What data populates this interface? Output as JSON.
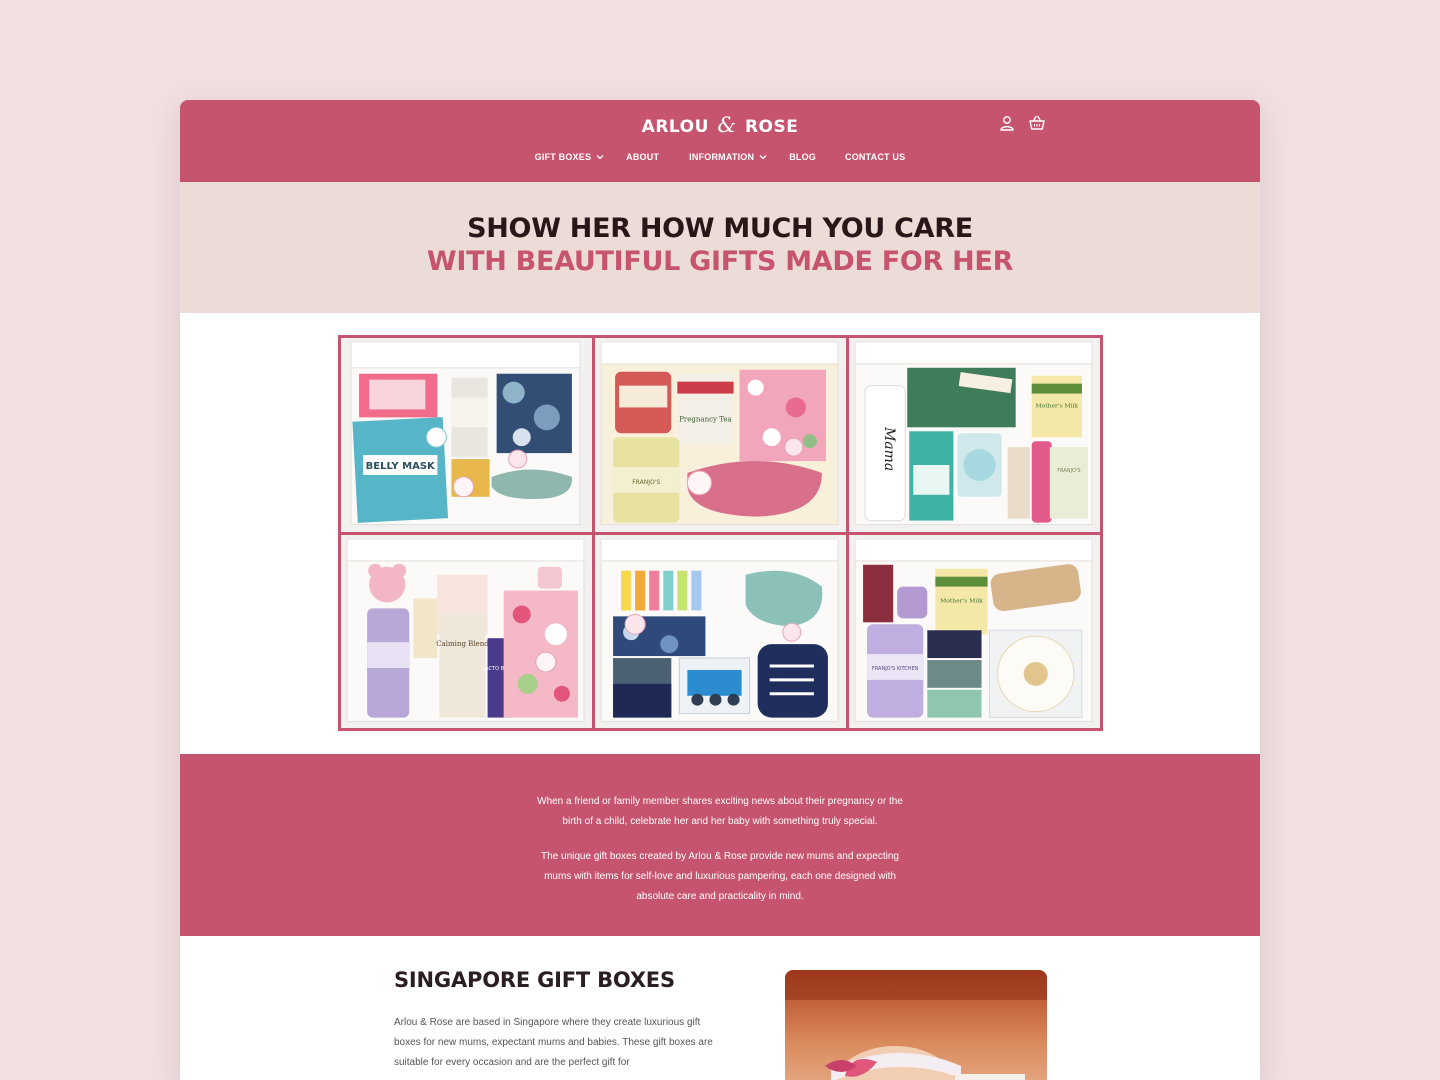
{
  "brand": {
    "name_left": "ARLOU",
    "amp": "&",
    "name_right": "ROSE"
  },
  "header_icons": [
    "account-icon",
    "basket-icon"
  ],
  "nav": [
    {
      "label": "GIFT BOXES",
      "dropdown": true
    },
    {
      "label": "ABOUT",
      "dropdown": false
    },
    {
      "label": "INFORMATION",
      "dropdown": true
    },
    {
      "label": "BLOG",
      "dropdown": false
    },
    {
      "label": "CONTACT US",
      "dropdown": false
    }
  ],
  "hero": {
    "line1": "SHOW HER HOW MUCH YOU CARE",
    "line2": "WITH BEAUTIFUL GIFTS MADE FOR HER"
  },
  "gallery": {
    "box_labels": [
      "BELLY MASK",
      "Pregnancy Tea",
      "Mama",
      "Mother's Milk",
      "Calming Blend",
      "LACTO BITES",
      "FRANJO'S KITCHEN"
    ]
  },
  "about": {
    "para1": "When a friend or family member shares exciting news about their pregnancy or the birth of a child, celebrate her and her baby with something truly special.",
    "para2": "The unique gift boxes created by Arlou & Rose provide new mums and expecting mums with items for self-love and luxurious pampering, each one designed with absolute care and practicality in mind."
  },
  "singapore": {
    "title": "SINGAPORE GIFT BOXES",
    "text": "Arlou & Rose are based in Singapore where they create luxurious gift boxes for new mums, expectant mums and babies. These gift boxes are suitable for every occasion and are the perfect gift for"
  },
  "colors": {
    "brand": "#c7546e",
    "hero_bg": "#ecdcd8",
    "page_bg": "#f1dfe2",
    "dark_text": "#2a1518"
  }
}
